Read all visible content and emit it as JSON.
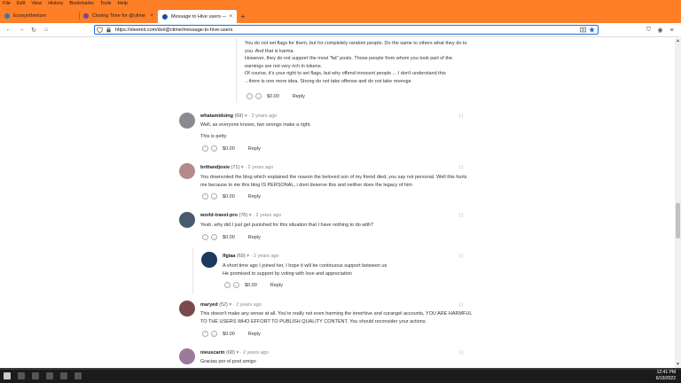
{
  "menubar": [
    "File",
    "Edit",
    "View",
    "History",
    "Bookmarks",
    "Tools",
    "Help"
  ],
  "tabs": [
    {
      "label": "Ecosynthesizer",
      "favicon_color": "#2a7ab8",
      "active": false
    },
    {
      "label": "Closing Time for @ctime @fer",
      "favicon_color": "#6b4c9a",
      "active": false
    },
    {
      "label": "Message to Hive users — Steem",
      "favicon_color": "#1a5099",
      "active": true
    }
  ],
  "newtab_label": "+",
  "nav": {
    "back": "←",
    "forward": "→",
    "reload": "↻",
    "home": "⌂"
  },
  "url": "https://steemit.com/dvi/@ctime/message-to-hive-users",
  "top_block": {
    "lines": [
      "You do not set flags for them, but for completely random people. Do the same to others what they do to",
      "you. And that is karma.",
      "However, they do not support the most \"fat\" posts. Those people from whom you took part of the",
      "earnings are not very rich in tokens.",
      "Of course, it's your right to set flags, but why offend innocent people ... I don't understand this",
      "...there is one more idea. Strong do not take offense and do not take revenge"
    ],
    "payout": "$0.00",
    "reply": "Reply"
  },
  "comments": [
    {
      "author": "whatamidoing",
      "rep": "(69)",
      "time": "2 years ago",
      "lines": [
        "Well, as everyone knows, two wrongs make a right.",
        "This is petty"
      ],
      "payout": "$0.00",
      "reply": "Reply",
      "avatar_color": "#8a8a92"
    },
    {
      "author": "brittandjosie",
      "rep": "(71)",
      "time": "2 years ago",
      "lines": [
        "You downvoted the blog which explained the reason the beloved son of my friend died, you say not personal. Well this hurts",
        "me because to me this blog IS PERSONAL, i dont deserve this and neither does the legacy of him"
      ],
      "payout": "$0.00",
      "reply": "Reply",
      "avatar_color": "#b58a8a"
    },
    {
      "author": "world-travel-pro",
      "rep": "(76)",
      "time": "2 years ago",
      "lines": [
        "Yeah, why did I just get punished for this situation that I have nothing to do with?"
      ],
      "payout": "$0.00",
      "reply": "Reply",
      "avatar_color": "#4a5a6e"
    },
    {
      "author": "lfgiaa",
      "rep": "(69)",
      "time": "2 years ago",
      "lines": [
        "A short time ago I joined her, I hope it will be continuous support between us",
        "He promised to support by voting with love and appreciation"
      ],
      "payout": "$0.00",
      "reply": "Reply",
      "avatar_color": "#1b3a5c"
    },
    {
      "author": "maryed",
      "rep": "(52)",
      "time": "2 years ago",
      "lines": [
        "This doesn't make any sense at all. You're really not even harming the innerhive and curangel accounts, YOU ARE HARMFUL",
        "TO THE USERS WHO EFFORT TO PUBLISH QUALITY CONTENT. You should reconsider your actions."
      ],
      "payout": "$0.00",
      "reply": "Reply",
      "avatar_color": "#7a4a4a"
    },
    {
      "author": "nieuscarin",
      "rep": "(68)",
      "time": "2 years ago",
      "lines": [
        "Gracias por el post amigo"
      ],
      "payout": "",
      "reply": "",
      "avatar_color": "#9a7a9a"
    }
  ],
  "collapse_symbol": "[-]",
  "taskbar": {
    "time": "12:41 PM",
    "date": "6/19/2022"
  }
}
